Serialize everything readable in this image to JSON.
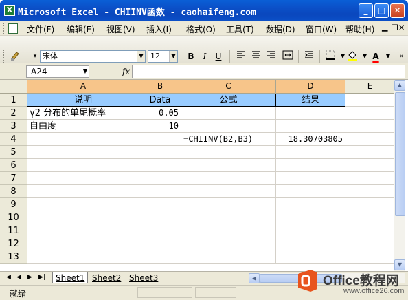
{
  "window": {
    "title": "Microsoft Excel - CHIINV函数 - caohaifeng.com",
    "minimize": "_",
    "maximize": "□",
    "close": "✕"
  },
  "menu": {
    "items": [
      "文件(F)",
      "编辑(E)",
      "视图(V)",
      "插入(I)",
      "格式(O)",
      "工具(T)",
      "数据(D)",
      "窗口(W)",
      "帮助(H)"
    ],
    "doc_minimize": "▁",
    "doc_restore": "❐",
    "doc_close": "✕"
  },
  "toolbar": {
    "font_name": "宋体",
    "font_size": "12",
    "bold": "B",
    "italic": "I",
    "underline": "U",
    "font_color_label": "A"
  },
  "formula_bar": {
    "name_box": "A24",
    "fx": "fx",
    "content": ""
  },
  "sheet": {
    "columns": [
      "A",
      "B",
      "C",
      "D",
      "E"
    ],
    "selected_columns": [
      "A",
      "B",
      "C",
      "D"
    ],
    "rows": [
      "1",
      "2",
      "3",
      "4",
      "5",
      "6",
      "7",
      "8",
      "9",
      "10",
      "11",
      "12",
      "13"
    ],
    "cells": {
      "A1": "说明",
      "B1": "Data",
      "C1": "公式",
      "D1": "结果",
      "A2": "γ2 分布的单尾概率",
      "B2": "0.05",
      "A3": "自由度",
      "B3": "10",
      "C4": "=CHIINV(B2,B3)",
      "D4": "18.30703805"
    }
  },
  "tabs": {
    "nav": [
      "|◀",
      "◀",
      "▶",
      "▶|"
    ],
    "sheets": [
      "Sheet1",
      "Sheet2",
      "Sheet3"
    ],
    "active": "Sheet1"
  },
  "status": {
    "text": "就绪"
  },
  "watermark": {
    "brand": "Office教程网",
    "url": "www.office26.com",
    "color": "#e8541e"
  }
}
